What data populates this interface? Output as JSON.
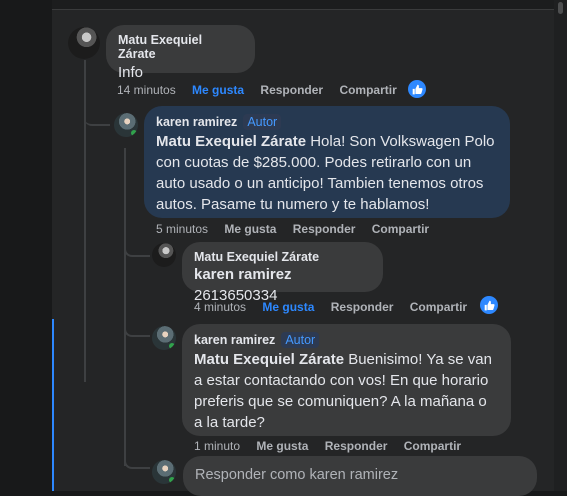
{
  "comments": [
    {
      "author": "Matu Exequiel Zárate",
      "badge": "",
      "mention": "",
      "text": "Info",
      "time": "14 minutos",
      "like": "Me gusta",
      "reply": "Responder",
      "share": "Compartir",
      "liked": true
    },
    {
      "author": "karen ramirez",
      "badge": "Autor",
      "mention": "Matu Exequiel Zárate",
      "text": " Hola! Son Volkswagen Polo con cuotas de $285.000. Podes retirarlo con un auto usado o un anticipo! Tambien tenemos otros autos. Pasame tu numero y te hablamos!",
      "time": "5 minutos",
      "like": "Me gusta",
      "reply": "Responder",
      "share": "Compartir",
      "liked": false
    },
    {
      "author": "Matu Exequiel Zárate",
      "badge": "",
      "mention": "karen ramirez",
      "text": " 2613650334",
      "time": "4 minutos",
      "like": "Me gusta",
      "reply": "Responder",
      "share": "Compartir",
      "liked": true
    },
    {
      "author": "karen ramirez",
      "badge": "Autor",
      "mention": "Matu Exequiel Zárate",
      "text": " Buenisimo! Ya se van a estar contactando con vos! En que horario preferis que se comuniquen? A la mañana o a la tarde?",
      "time": "1 minuto",
      "like": "Me gusta",
      "reply": "Responder",
      "share": "Compartir",
      "liked": false
    }
  ],
  "reply_box": {
    "placeholder": "Responder como karen ramirez"
  },
  "colors": {
    "background": "#18191a",
    "panel": "#242526",
    "bubble": "#3a3b3c",
    "author_bubble": "#263951",
    "accent": "#2d88ff",
    "secondary_text": "#b0b3b8"
  }
}
